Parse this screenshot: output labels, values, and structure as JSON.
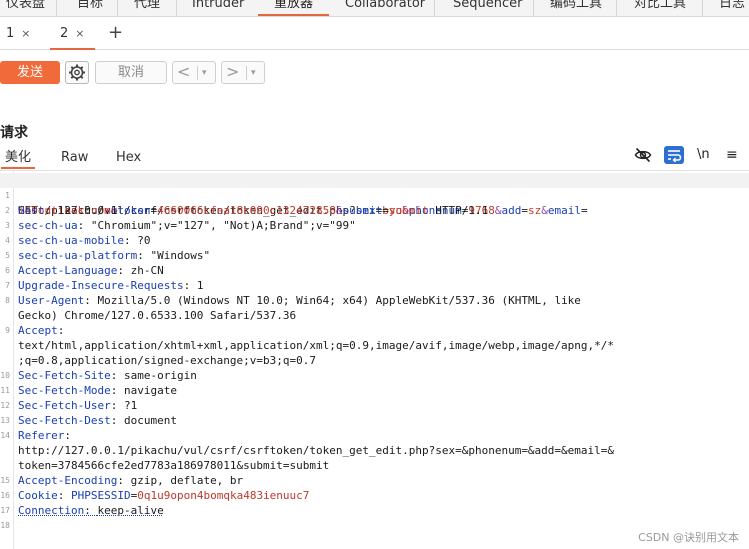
{
  "top_tabs": [
    "仪表盘",
    "目标",
    "代理",
    "Intruder",
    "重放器",
    "Collaborator",
    "Sequencer",
    "编码工具",
    "对比工具",
    "日志"
  ],
  "repeater_tabs": [
    {
      "label": "1",
      "close": "×"
    },
    {
      "label": "2",
      "close": "×"
    }
  ],
  "add_tab": "+",
  "toolbar": {
    "send": "发送",
    "cancel": "取消",
    "prev": "<",
    "next": ">",
    "dropdown": "▾"
  },
  "request": {
    "title": "请求",
    "view_tabs": [
      "美化",
      "Raw",
      "Hex"
    ],
    "newline_label": "\\n",
    "menu_glyph": "≡"
  },
  "raw_request": {
    "line1": {
      "num": "1",
      "method": "GET /pikachu/vul/csrf/csrftoken/token_get_edit.php?",
      "params": [
        {
          "name": "sex",
          "value": "byo"
        },
        {
          "name": "phonenum",
          "value": "9768"
        },
        {
          "name": "add",
          "value": "sz"
        },
        {
          "name": "email",
          "value": ""
        }
      ]
    },
    "line1_cont": {
      "email_value": "%40outlook.com",
      "token_name": "token",
      "token_value": "4660066cfea18c090c132472858",
      "submit_name": "submit",
      "submit_value": "submit",
      "protocol": " HTTP/1.1"
    },
    "headers": [
      {
        "num": "2",
        "name": "Host",
        "value": "127.0.0.1"
      },
      {
        "num": "3",
        "name": "sec-ch-ua",
        "value": "\"Chromium\";v=\"127\", \"Not)A;Brand\";v=\"99\""
      },
      {
        "num": "4",
        "name": "sec-ch-ua-mobile",
        "value": "?0"
      },
      {
        "num": "5",
        "name": "sec-ch-ua-platform",
        "value": "\"Windows\""
      },
      {
        "num": "6",
        "name": "Accept-Language",
        "value": "zh-CN"
      },
      {
        "num": "7",
        "name": "Upgrade-Insecure-Requests",
        "value": "1"
      },
      {
        "num": "8",
        "name": "User-Agent",
        "value": "Mozilla/5.0 (Windows NT 10.0; Win64; x64) AppleWebKit/537.36 (KHTML, like"
      }
    ],
    "ua_cont": "Gecko) Chrome/127.0.6533.100 Safari/537.36",
    "accept": {
      "num": "9",
      "name": "Accept",
      "line1": "text/html,application/xhtml+xml,application/xml;q=0.9,image/avif,image/webp,image/apng,*/*",
      "line2": ";q=0.8,application/signed-exchange;v=b3;q=0.7"
    },
    "headers2": [
      {
        "num": "10",
        "name": "Sec-Fetch-Site",
        "value": "same-origin"
      },
      {
        "num": "11",
        "name": "Sec-Fetch-Mode",
        "value": "navigate"
      },
      {
        "num": "12",
        "name": "Sec-Fetch-User",
        "value": "?1"
      },
      {
        "num": "13",
        "name": "Sec-Fetch-Dest",
        "value": "document"
      }
    ],
    "referer": {
      "num": "14",
      "name": "Referer",
      "line1": "http://127.0.0.1/pikachu/vul/csrf/csrftoken/token_get_edit.php?sex=&phonenum=&add=&email=&",
      "line2": "token=3784566cfe2ed7783a186978011&submit=submit"
    },
    "headers3": [
      {
        "num": "15",
        "name": "Accept-Encoding",
        "value": "gzip, deflate, br"
      }
    ],
    "cookie": {
      "num": "16",
      "name": "Cookie",
      "cname": "PHPSESSID",
      "cvalue": "0q1u9opon4bomqka483ienuuc7"
    },
    "connection": {
      "num": "17",
      "name": "Connection",
      "value": "keep-alive"
    },
    "line18": {
      "num": "18"
    }
  },
  "watermark": "CSDN @诀别用文本"
}
